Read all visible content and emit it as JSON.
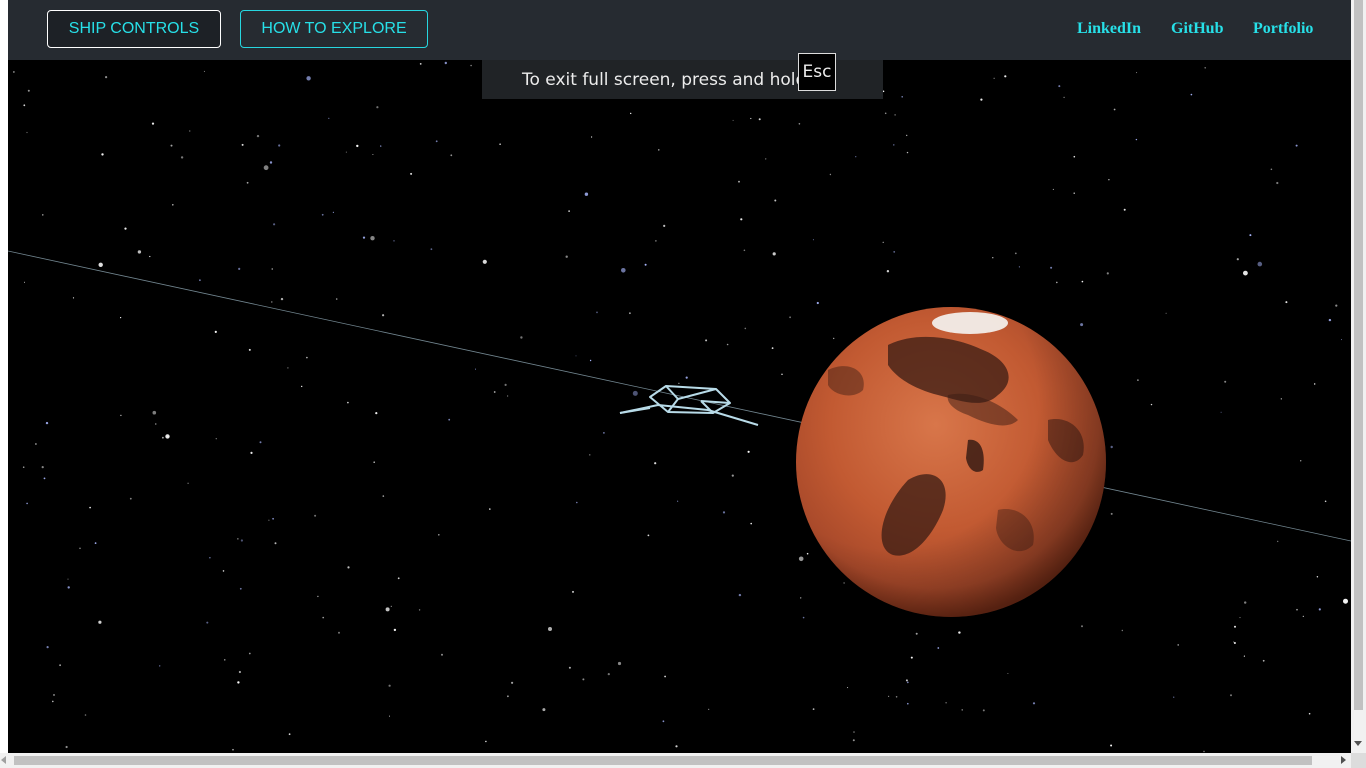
{
  "navbar": {
    "buttons": [
      {
        "label": "SHIP CONTROLS"
      },
      {
        "label": "HOW TO EXPLORE"
      }
    ],
    "links": [
      {
        "label": "LinkedIn"
      },
      {
        "label": "GitHub"
      },
      {
        "label": "Portfolio"
      }
    ]
  },
  "fullscreen_notice": {
    "text": "To exit full screen, press and hold",
    "key": "Esc"
  },
  "scene": {
    "planet": "mars",
    "ship": "wireframe-spaceship",
    "background": "starfield",
    "colors": {
      "accent": "#27e0e8",
      "navbar": "#262b31",
      "space": "#000000",
      "planet": "#c0552e",
      "ship_wire": "#a8d0e0"
    }
  }
}
